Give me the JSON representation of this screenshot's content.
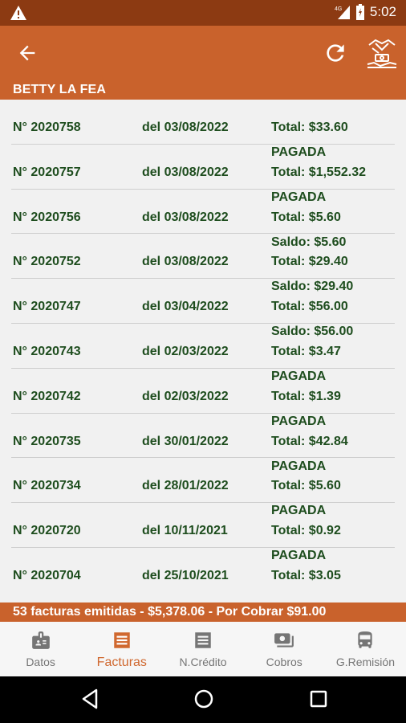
{
  "status_bar": {
    "network": "4G",
    "time": "5:02"
  },
  "header": {
    "client_name": "BETTY LA FEA"
  },
  "invoices": [
    {
      "number": "N° 2020758",
      "date": "del 03/08/2022",
      "total": "Total: $33.60",
      "status": "PAGADA"
    },
    {
      "number": "N° 2020757",
      "date": "del 03/08/2022",
      "total": "Total: $1,552.32",
      "status": "PAGADA"
    },
    {
      "number": "N° 2020756",
      "date": "del 03/08/2022",
      "total": "Total: $5.60",
      "status": "Saldo: $5.60"
    },
    {
      "number": "N° 2020752",
      "date": "del 03/08/2022",
      "total": "Total: $29.40",
      "status": "Saldo: $29.40"
    },
    {
      "number": "N° 2020747",
      "date": "del 03/04/2022",
      "total": "Total: $56.00",
      "status": "Saldo: $56.00"
    },
    {
      "number": "N° 2020743",
      "date": "del 02/03/2022",
      "total": "Total: $3.47",
      "status": "PAGADA"
    },
    {
      "number": "N° 2020742",
      "date": "del 02/03/2022",
      "total": "Total: $1.39",
      "status": "PAGADA"
    },
    {
      "number": "N° 2020735",
      "date": "del 30/01/2022",
      "total": "Total: $42.84",
      "status": "PAGADA"
    },
    {
      "number": "N° 2020734",
      "date": "del 28/01/2022",
      "total": "Total: $5.60",
      "status": "PAGADA"
    },
    {
      "number": "N° 2020720",
      "date": "del 10/11/2021",
      "total": "Total: $0.92",
      "status": "PAGADA"
    },
    {
      "number": "N° 2020704",
      "date": "del 25/10/2021",
      "total": "Total: $3.05",
      "status": ""
    }
  ],
  "summary": "53 facturas emitidas - $5,378.06 - Por Cobrar $91.00",
  "bottom_nav": [
    {
      "label": "Datos",
      "icon": "id-badge-icon",
      "active": false
    },
    {
      "label": "Facturas",
      "icon": "invoice-list-icon",
      "active": true
    },
    {
      "label": "N.Crédito",
      "icon": "credit-note-icon",
      "active": false
    },
    {
      "label": "Cobros",
      "icon": "cash-icon",
      "active": false
    },
    {
      "label": "G.Remisión",
      "icon": "bus-icon",
      "active": false
    }
  ],
  "colors": {
    "primary": "#c9622c",
    "status_bar": "#8c3a12",
    "text_green": "#1e4d1e",
    "active_tab": "#d0682f"
  }
}
